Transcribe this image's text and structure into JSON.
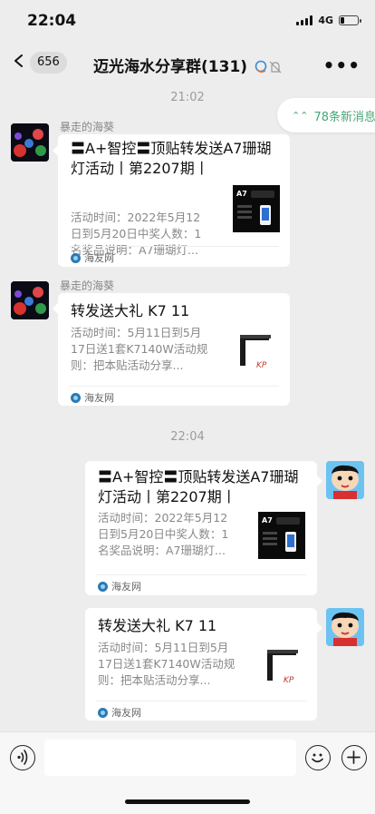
{
  "status_bar": {
    "time": "22:04",
    "network": "4G"
  },
  "nav": {
    "back_count": "656",
    "title": "迈光海水分享群(131)"
  },
  "unread": {
    "label": "78条新消息"
  },
  "separators": [
    "21:02",
    "22:04"
  ],
  "messages": [
    {
      "sender": "暴走的海葵",
      "title": "〓A+智控〓顶贴转发送A7珊瑚灯活动丨第2207期丨",
      "desc": "活动时间：2022年5月12日到5月20日中奖人数：1名奖品说明：A7珊瑚灯...",
      "thumb": "A7",
      "source": "海友网"
    },
    {
      "sender": "暴走的海葵",
      "title": "转发送大礼 K7 11",
      "desc": "活动时间：5月11日到5月17日送1套K7140W活动规则：把本贴活动分享...",
      "source": "海友网"
    },
    {
      "title": "〓A+智控〓顶贴转发送A7珊瑚灯活动丨第2207期丨",
      "desc": "活动时间：2022年5月12日到5月20日中奖人数：1名奖品说明：A7珊瑚灯...",
      "thumb": "A7",
      "source": "海友网"
    },
    {
      "title": "转发送大礼 K7 11",
      "desc": "活动时间：5月11日到5月17日送1套K7140W活动规则：把本贴活动分享...",
      "source": "海友网"
    }
  ],
  "icons": {
    "back": "chevron-left-icon",
    "more": "more-icon",
    "mute": "bell-off-icon",
    "unread": "double-chevron-up-icon",
    "voice": "voice-icon",
    "emoji": "emoji-icon",
    "plus": "plus-icon"
  },
  "colors": {
    "background": "#ededed",
    "unread_text": "#46a776",
    "card": "#ffffff"
  }
}
